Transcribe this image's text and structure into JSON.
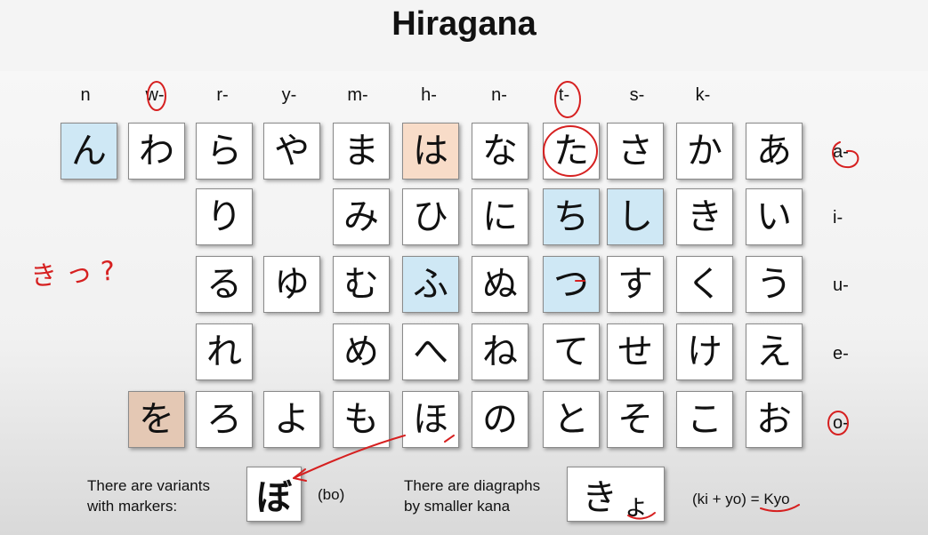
{
  "title": "Hiragana",
  "column_labels": [
    "n",
    "w-",
    "r-",
    "y-",
    "m-",
    "h-",
    "n-",
    "t-",
    "s-",
    "k-"
  ],
  "row_labels": [
    "a-",
    "i-",
    "u-",
    "e-",
    "o-"
  ],
  "rows": {
    "a": [
      "ん",
      "わ",
      "ら",
      "や",
      "ま",
      "は",
      "な",
      "た",
      "さ",
      "か",
      "あ"
    ],
    "i": [
      "り",
      "み",
      "ひ",
      "に",
      "ち",
      "し",
      "き",
      "い"
    ],
    "u": [
      "る",
      "ゆ",
      "む",
      "ふ",
      "ぬ",
      "つ",
      "す",
      "く",
      "う"
    ],
    "e": [
      "れ",
      "め",
      "へ",
      "ね",
      "て",
      "せ",
      "け",
      "え"
    ],
    "o": [
      "を",
      "ろ",
      "よ",
      "も",
      "ほ",
      "の",
      "と",
      "そ",
      "こ",
      "お"
    ]
  },
  "highlight_colors": {
    "blue": "#cfe8f5",
    "peach": "#f8dcc8",
    "tan": "#e4c8b4"
  },
  "annotation_color": "#d62020",
  "handwritten_note": "き っ ?",
  "notes": {
    "variants_line1": "There are variants",
    "variants_line2": "with markers:",
    "variant_example": "ぼ",
    "variant_reading": "(bo)",
    "diagraphs_line1": "There are diagraphs",
    "diagraphs_line2": "by smaller kana",
    "diagraph_big": "き",
    "diagraph_small": "ょ",
    "diagraph_reading_prefix": "(ki + yo) = ",
    "diagraph_reading_result": "Kyo"
  }
}
